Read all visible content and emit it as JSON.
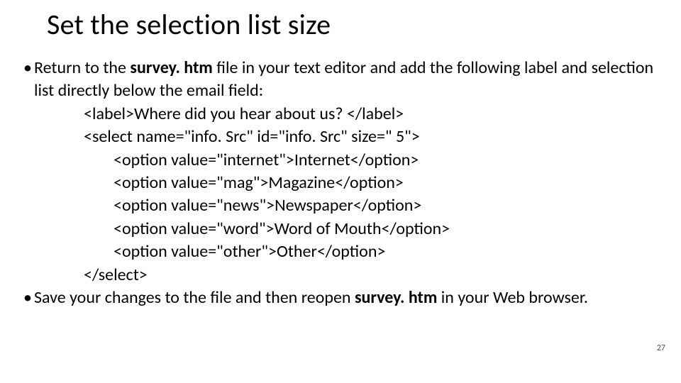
{
  "title": "Set the selection list size",
  "bullets": {
    "b1_pre": "Return to the ",
    "b1_bold": "survey. htm",
    "b1_post": " file in your text editor and add the following label and selection list directly below the email field:",
    "b2_pre": "Save your changes to the file and then reopen ",
    "b2_bold": "survey. htm",
    "b2_post": " in your Web browser."
  },
  "code": {
    "l1": "<label>Where did you hear about us? </label>",
    "l2": "<select name=\"info. Src\" id=\"info. Src\" size=\" 5\">",
    "l3": "<option value=\"internet\">Internet</option>",
    "l4": "<option value=\"mag\">Magazine</option>",
    "l5": "<option value=\"news\">Newspaper</option>",
    "l6": "<option value=\"word\">Word of Mouth</option>",
    "l7": "<option value=\"other\">Other</option>",
    "l8": "</select>"
  },
  "page_number": "27"
}
